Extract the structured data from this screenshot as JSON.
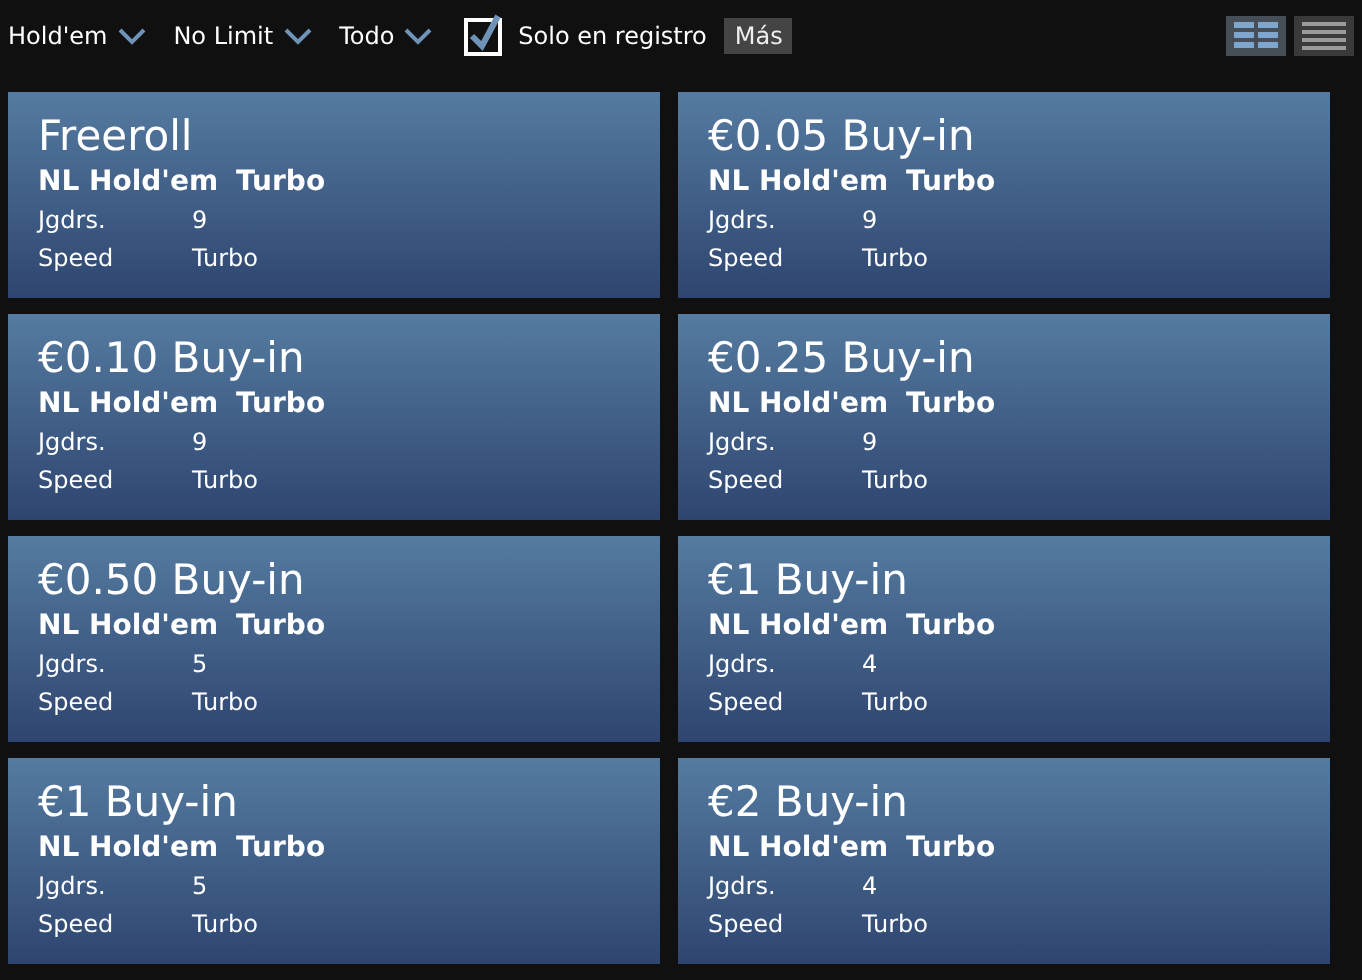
{
  "filters": [
    {
      "label": "Hold'em"
    },
    {
      "label": "No Limit"
    },
    {
      "label": "Todo"
    }
  ],
  "registered_only": {
    "label": "Solo en registro",
    "checked": true
  },
  "more_button": "Más",
  "view_toggle": [
    {
      "kind": "grid",
      "selected": true
    },
    {
      "kind": "list",
      "selected": false
    }
  ],
  "tournaments": [
    {
      "title": "Freeroll",
      "game": "NL Hold'em",
      "type": "Turbo",
      "rows": [
        {
          "label": "Jgdrs.",
          "value": "9"
        },
        {
          "label": "Speed",
          "value": "Turbo"
        }
      ]
    },
    {
      "title": "€0.05 Buy-in",
      "game": "NL Hold'em",
      "type": "Turbo",
      "rows": [
        {
          "label": "Jgdrs.",
          "value": "9"
        },
        {
          "label": "Speed",
          "value": "Turbo"
        }
      ]
    },
    {
      "title": "€0.10 Buy-in",
      "game": "NL Hold'em",
      "type": "Turbo",
      "rows": [
        {
          "label": "Jgdrs.",
          "value": "9"
        },
        {
          "label": "Speed",
          "value": "Turbo"
        }
      ]
    },
    {
      "title": "€0.25 Buy-in",
      "game": "NL Hold'em",
      "type": "Turbo",
      "rows": [
        {
          "label": "Jgdrs.",
          "value": "9"
        },
        {
          "label": "Speed",
          "value": "Turbo"
        }
      ]
    },
    {
      "title": "€0.50 Buy-in",
      "game": "NL Hold'em",
      "type": "Turbo",
      "rows": [
        {
          "label": "Jgdrs.",
          "value": "5"
        },
        {
          "label": "Speed",
          "value": "Turbo"
        }
      ]
    },
    {
      "title": "€1 Buy-in",
      "game": "NL Hold'em",
      "type": "Turbo",
      "rows": [
        {
          "label": "Jgdrs.",
          "value": "4"
        },
        {
          "label": "Speed",
          "value": "Turbo"
        }
      ]
    },
    {
      "title": "€1 Buy-in",
      "game": "NL Hold'em",
      "type": "Turbo",
      "rows": [
        {
          "label": "Jgdrs.",
          "value": "5"
        },
        {
          "label": "Speed",
          "value": "Turbo"
        }
      ]
    },
    {
      "title": "€2 Buy-in",
      "game": "NL Hold'em",
      "type": "Turbo",
      "rows": [
        {
          "label": "Jgdrs.",
          "value": "4"
        },
        {
          "label": "Speed",
          "value": "Turbo"
        }
      ]
    }
  ]
}
